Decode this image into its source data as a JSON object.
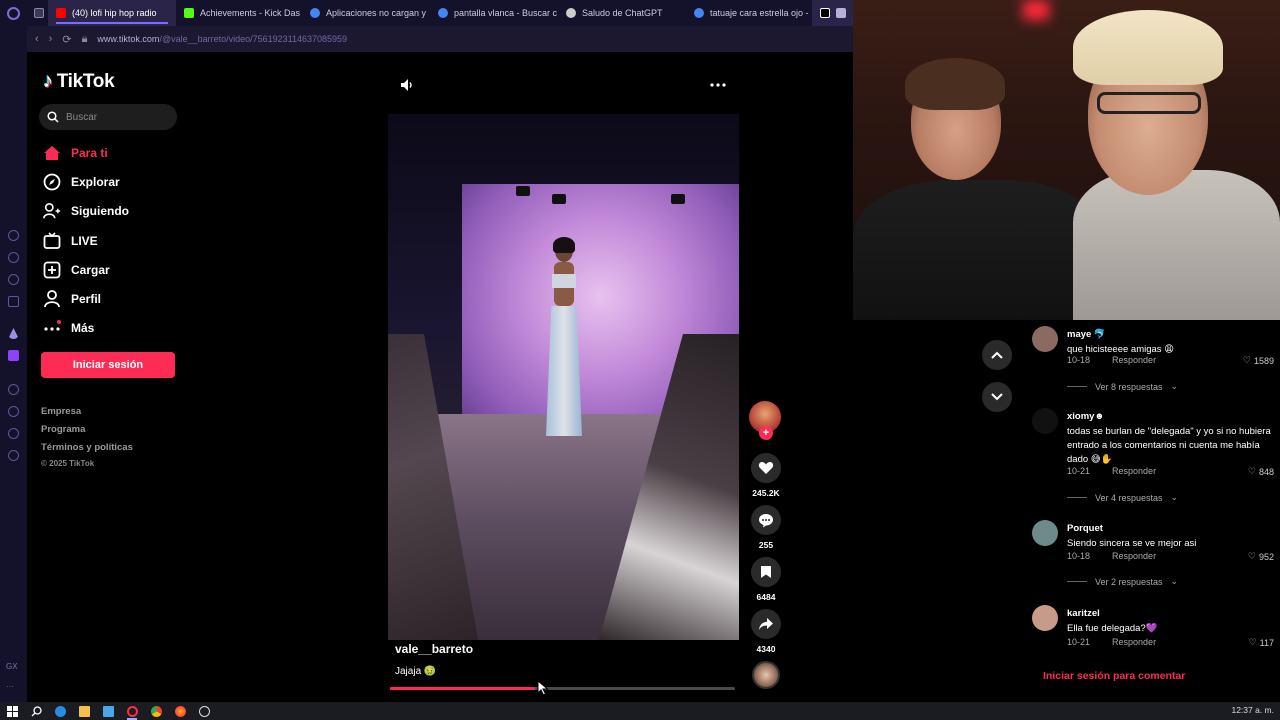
{
  "browser": {
    "tabs": [
      {
        "label": "",
        "favicon_color": "#3a3a55",
        "active": false
      },
      {
        "label": "(40) lofi hip hop radio",
        "favicon_color": "#ff0000",
        "active": true
      },
      {
        "label": "Achievements - Kick Das",
        "favicon_color": "#53fc18",
        "active": false
      },
      {
        "label": "Aplicaciones no cargan y",
        "favicon_color": "#4285f4",
        "active": false
      },
      {
        "label": "pantalla vlanca - Buscar c",
        "favicon_color": "#4285f4",
        "active": false
      },
      {
        "label": "Saludo de ChatGPT",
        "favicon_color": "#cccccc",
        "active": false
      },
      {
        "label": "tatuaje cara estrella ojo -",
        "favicon_color": "#4285f4",
        "active": false
      },
      {
        "label": "",
        "favicon_color": "#ffffff",
        "active": false
      }
    ],
    "url_host": "www.tiktok.com",
    "url_path": "/@vale__barreto/video/7561923114637085959",
    "side_panel_bottom_text": "GX"
  },
  "tiktok": {
    "logo_text": "TikTok",
    "search_placeholder": "Buscar",
    "nav": [
      {
        "label": "Para ti",
        "icon": "home-icon",
        "active": true
      },
      {
        "label": "Explorar",
        "icon": "compass-icon",
        "active": false
      },
      {
        "label": "Siguiendo",
        "icon": "following-icon",
        "active": false
      },
      {
        "label": "LIVE",
        "icon": "live-icon",
        "active": false
      },
      {
        "label": "Cargar",
        "icon": "upload-icon",
        "active": false
      },
      {
        "label": "Perfil",
        "icon": "profile-icon",
        "active": false
      },
      {
        "label": "Más",
        "icon": "more-icon",
        "active": false
      }
    ],
    "login_button": "Iniciar sesión",
    "footer": {
      "links": [
        "Empresa",
        "Programa",
        "Términos y políticas"
      ],
      "copyright": "© 2025 TikTok"
    },
    "video": {
      "username": "vale__barreto",
      "caption": "Jajaja 🤢",
      "progress": 0.42,
      "likes": "245.2K",
      "comments": "255",
      "saves": "6484",
      "shares": "4340"
    },
    "comments": [
      {
        "user": "maye 🐬",
        "text": "que hicisteeee amigas 😩",
        "date": "10-18",
        "likes": "1589",
        "replies": "Ver 8 respuestas",
        "avatar_color": "#8b6a62"
      },
      {
        "user": "xiomy☻",
        "text": "todas se burlan de \"delegada\" y yo si no hubiera entrado a los comentarios ni cuenta me había dado 😅✋",
        "date": "10-21",
        "likes": "848",
        "replies": "Ver 4 respuestas",
        "avatar_color": "#111111"
      },
      {
        "user": "Porquet",
        "text": "Siendo sincera se ve mejor asi",
        "date": "10-18",
        "likes": "952",
        "replies": "Ver 2 respuestas",
        "avatar_color": "#6e8a8a"
      },
      {
        "user": "karitzel",
        "text": "Ella fue delegada?💜",
        "date": "10-21",
        "likes": "117",
        "replies": "",
        "avatar_color": "#c89a8a"
      }
    ],
    "reply_label": "Responder",
    "comment_login": "Iniciar sesión para comentar"
  },
  "taskbar": {
    "clock": "12:37 a. m."
  }
}
